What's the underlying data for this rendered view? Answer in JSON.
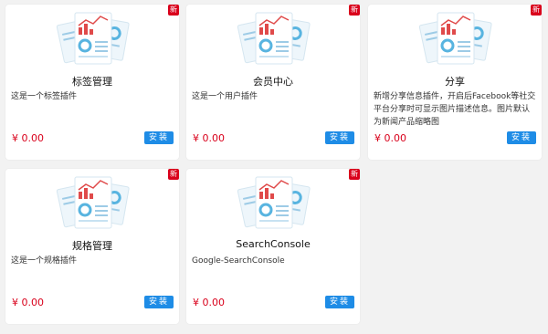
{
  "plugins": [
    {
      "title": "标签管理",
      "desc": "这是一个标签插件",
      "price": "¥ 0.00",
      "badge": "新",
      "action": "安装"
    },
    {
      "title": "会员中心",
      "desc": "这是一个用户插件",
      "price": "¥ 0.00",
      "badge": "新",
      "action": "安装"
    },
    {
      "title": "分享",
      "desc": "新增分享信息插件，开启后Facebook等社交平台分享时可显示图片描述信息。图片默认为新闻产品缩略图",
      "price": "¥ 0.00",
      "badge": "新",
      "action": "安装"
    },
    {
      "title": "规格管理",
      "desc": "这是一个规格插件",
      "price": "¥ 0.00",
      "badge": "新",
      "action": "安装"
    },
    {
      "title": "SearchConsole",
      "desc": "Google-SearchConsole",
      "price": "¥ 0.00",
      "badge": "新",
      "action": "安装"
    }
  ],
  "colors": {
    "background": "#f2f2f2",
    "card": "#ffffff",
    "price": "#d9001b",
    "badge": "#d9001b",
    "install_button": "#1e8ce6"
  },
  "icons": {
    "illustration": "report-documents-illustration"
  }
}
